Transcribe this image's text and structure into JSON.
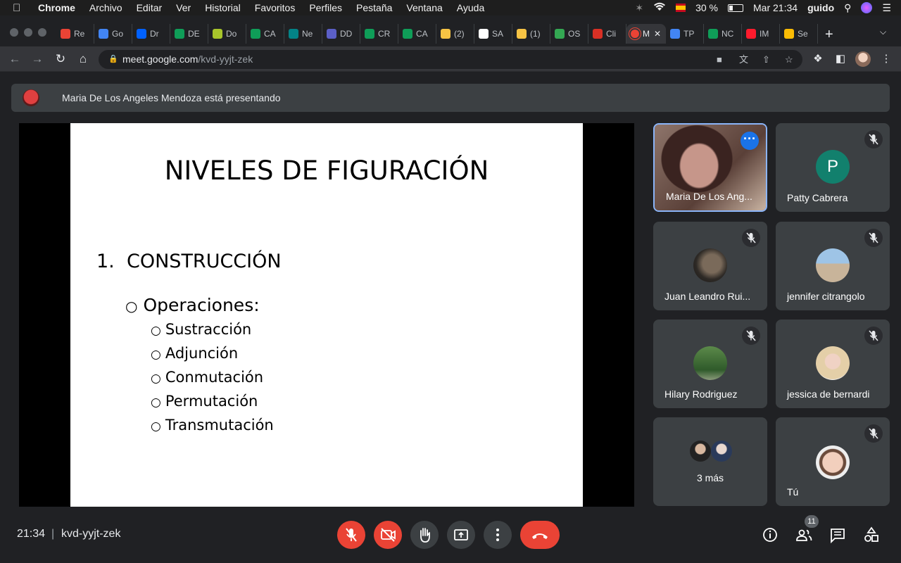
{
  "menubar": {
    "app": "Chrome",
    "items": [
      "Archivo",
      "Editar",
      "Ver",
      "Historial",
      "Favoritos",
      "Perfiles",
      "Pestaña",
      "Ventana",
      "Ayuda"
    ],
    "battery": "30 %",
    "clock": "Mar 21:34",
    "user": "guido"
  },
  "tabs": [
    {
      "label": "Re",
      "icon": "gmail-icon",
      "color": "#ea4335"
    },
    {
      "label": "Go",
      "icon": "calendar-icon",
      "color": "#4285f4"
    },
    {
      "label": "Dr",
      "icon": "dropbox-icon",
      "color": "#0061ff"
    },
    {
      "label": "DE",
      "icon": "sheets-icon",
      "color": "#0f9d58"
    },
    {
      "label": "Do",
      "icon": "download-icon",
      "color": "#a8c52b"
    },
    {
      "label": "CA",
      "icon": "sheets-icon",
      "color": "#0f9d58"
    },
    {
      "label": "Ne",
      "icon": "sharepoint-icon",
      "color": "#038387"
    },
    {
      "label": "DD",
      "icon": "wave-icon",
      "color": "#5b5fc7"
    },
    {
      "label": "CR",
      "icon": "sheets-icon",
      "color": "#0f9d58"
    },
    {
      "label": "CA",
      "icon": "sheets-icon",
      "color": "#0f9d58"
    },
    {
      "label": "(2)",
      "icon": "emoji-icon",
      "color": "#f6c344"
    },
    {
      "label": "SA",
      "icon": "google-icon",
      "color": "#ffffff"
    },
    {
      "label": "(1)",
      "icon": "emoji-icon",
      "color": "#f6c344"
    },
    {
      "label": "OS",
      "icon": "aperture-icon",
      "color": "#34a853"
    },
    {
      "label": "Cli",
      "icon": "cross-icon",
      "color": "#d93025"
    },
    {
      "label": "M",
      "icon": "recording-icon",
      "color": "#ea4335",
      "active": true
    },
    {
      "label": "TP",
      "icon": "docs-icon",
      "color": "#4285f4"
    },
    {
      "label": "NC",
      "icon": "sheets-icon",
      "color": "#0f9d58"
    },
    {
      "label": "IM",
      "icon": "opera-icon",
      "color": "#ff1b2d"
    },
    {
      "label": "Se",
      "icon": "drive-icon",
      "color": "#fbbc04"
    }
  ],
  "address": {
    "domain": "meet.google.com",
    "path": "/kvd-yyjt-zek"
  },
  "banner": {
    "text": "Maria De Los Angeles Mendoza está presentando"
  },
  "slide": {
    "title": "NIVELES DE FIGURACIÓN",
    "number": "1.",
    "heading": "CONSTRUCCIÓN",
    "bullet": "○",
    "subheading": "Operaciones:",
    "items": [
      "Sustracción",
      "Adjunción",
      "Conmutación",
      "Permutación",
      "Transmutación"
    ]
  },
  "participants": [
    {
      "name": "Maria De Los Ang...",
      "type": "video"
    },
    {
      "name": "Patty Cabrera",
      "initial": "P",
      "avatar_color": "#12806d"
    },
    {
      "name": "Juan Leandro Rui..."
    },
    {
      "name": "jennifer citrangolo"
    },
    {
      "name": "Hilary Rodriguez"
    },
    {
      "name": "jessica de bernardi"
    },
    {
      "name": "3 más"
    },
    {
      "name": "Tú"
    }
  ],
  "bottom": {
    "time": "21:34",
    "separator": "|",
    "meeting_code": "kvd-yyjt-zek",
    "people_count": "11"
  }
}
